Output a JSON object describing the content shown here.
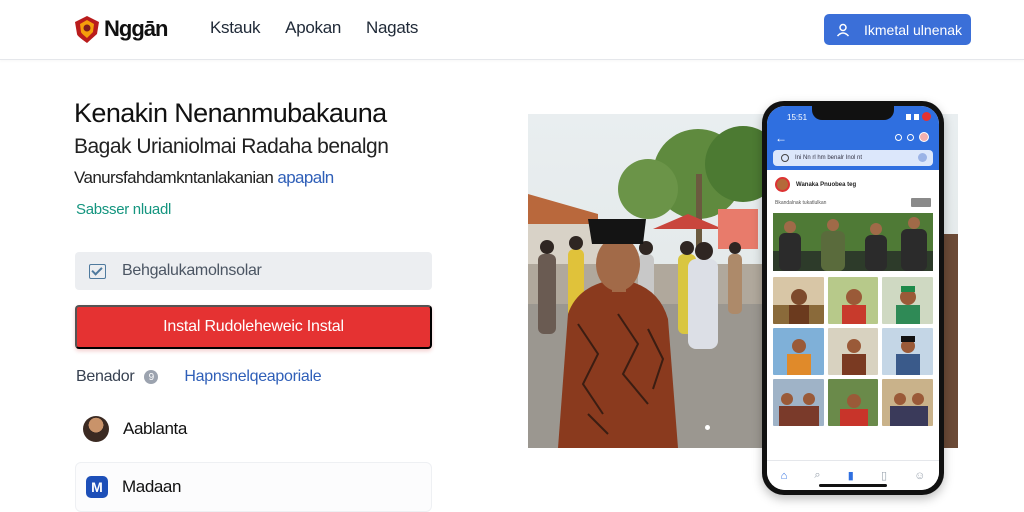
{
  "header": {
    "logo_text": "Nggān",
    "nav": [
      "Kstauk",
      "Apokan",
      "Nagats"
    ],
    "login_label": "Ikmetal ulnenak"
  },
  "hero": {
    "title": "Kenakin Nenanmubakauna",
    "subtitle": "Bagak Urianiolmai Radaha benalgn",
    "desc_main": "Vanursfahdamkntanlakanian ",
    "desc_link": "apapaln",
    "tag": "Sabsser nluadl"
  },
  "form": {
    "input_label": "Behgalukamolnsolar",
    "install_label": "Instal Rudoleheweic Instal"
  },
  "rating": {
    "label": "Benador",
    "icon_text": "9",
    "link": "Hapnsnelqeaporiale"
  },
  "list": {
    "item1": "Aablanta",
    "item2": "Madaan",
    "item2_icon": "M"
  },
  "phone": {
    "time": "15:51",
    "search": "Ini Nn rl hm benalr Inol nt",
    "post_title": "Wanaka Pnuobea teg",
    "post_meta": "Bkandalnak tukatlulkan"
  },
  "colors": {
    "primary": "#3b6fd8",
    "install": "#e53232",
    "accent_teal": "#14957f",
    "link": "#2f5fb8"
  }
}
